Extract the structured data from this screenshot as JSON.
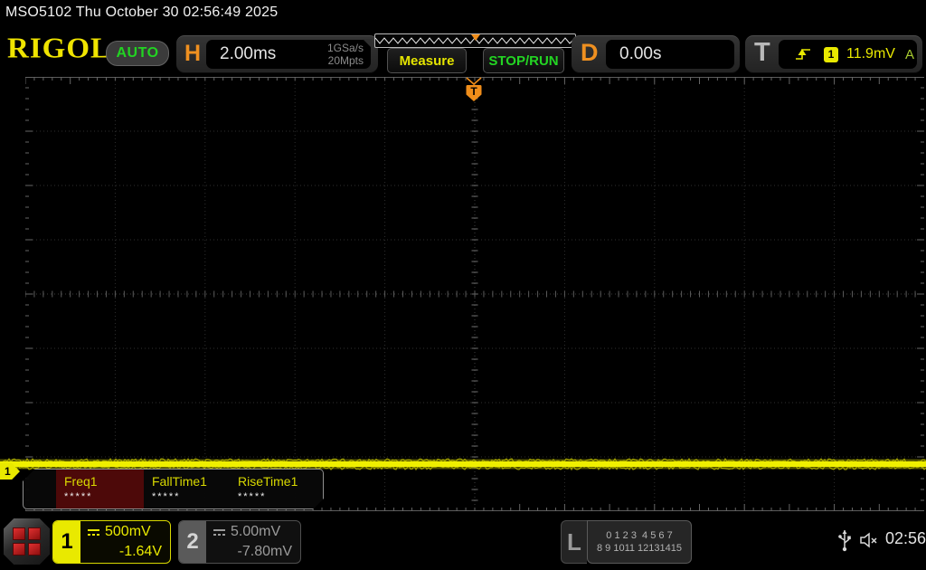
{
  "top_bar": {
    "title": "MSO5102  Thu October 30 02:56:49 2025"
  },
  "header": {
    "logo": "RIGOL",
    "mode_label": "AUTO",
    "horizontal": {
      "label": "H",
      "timebase": "2.00ms",
      "sample_rate": "1GSa/s",
      "memory_depth": "20Mpts"
    },
    "measure_label": "Measure",
    "stop_run_label": "STOP/RUN",
    "delay": {
      "label": "D",
      "value": "0.00s"
    },
    "trigger": {
      "label": "T",
      "source_badge": "1",
      "level": "11.9mV",
      "sweep_mode": "A"
    }
  },
  "measurements": {
    "items": [
      {
        "label": "Freq1",
        "value": "*****"
      },
      {
        "label": "FallTime1",
        "value": "*****"
      },
      {
        "label": "RiseTime1",
        "value": "*****"
      }
    ]
  },
  "trace": {
    "channel_marker": "1"
  },
  "trigger_marker_label": "T",
  "bottom_bar": {
    "ch1": {
      "number": "1",
      "scale": "500mV",
      "offset": "-1.64V"
    },
    "ch2": {
      "number": "2",
      "scale": "5.00mV",
      "offset": "-7.80mV"
    },
    "logic": {
      "label": "L",
      "row1": "0 1 2 3  4 5 6 7",
      "row2": "8 9 1011 12131415"
    },
    "clock": "02:56"
  },
  "colors": {
    "accent_yellow": "#e9e900",
    "accent_orange": "#ef9020",
    "accent_green": "#23d523",
    "trigger_mode_green": "#a8cc30",
    "measure_red_bg": "#4d0909",
    "grid_line": "#2f2f2f"
  }
}
